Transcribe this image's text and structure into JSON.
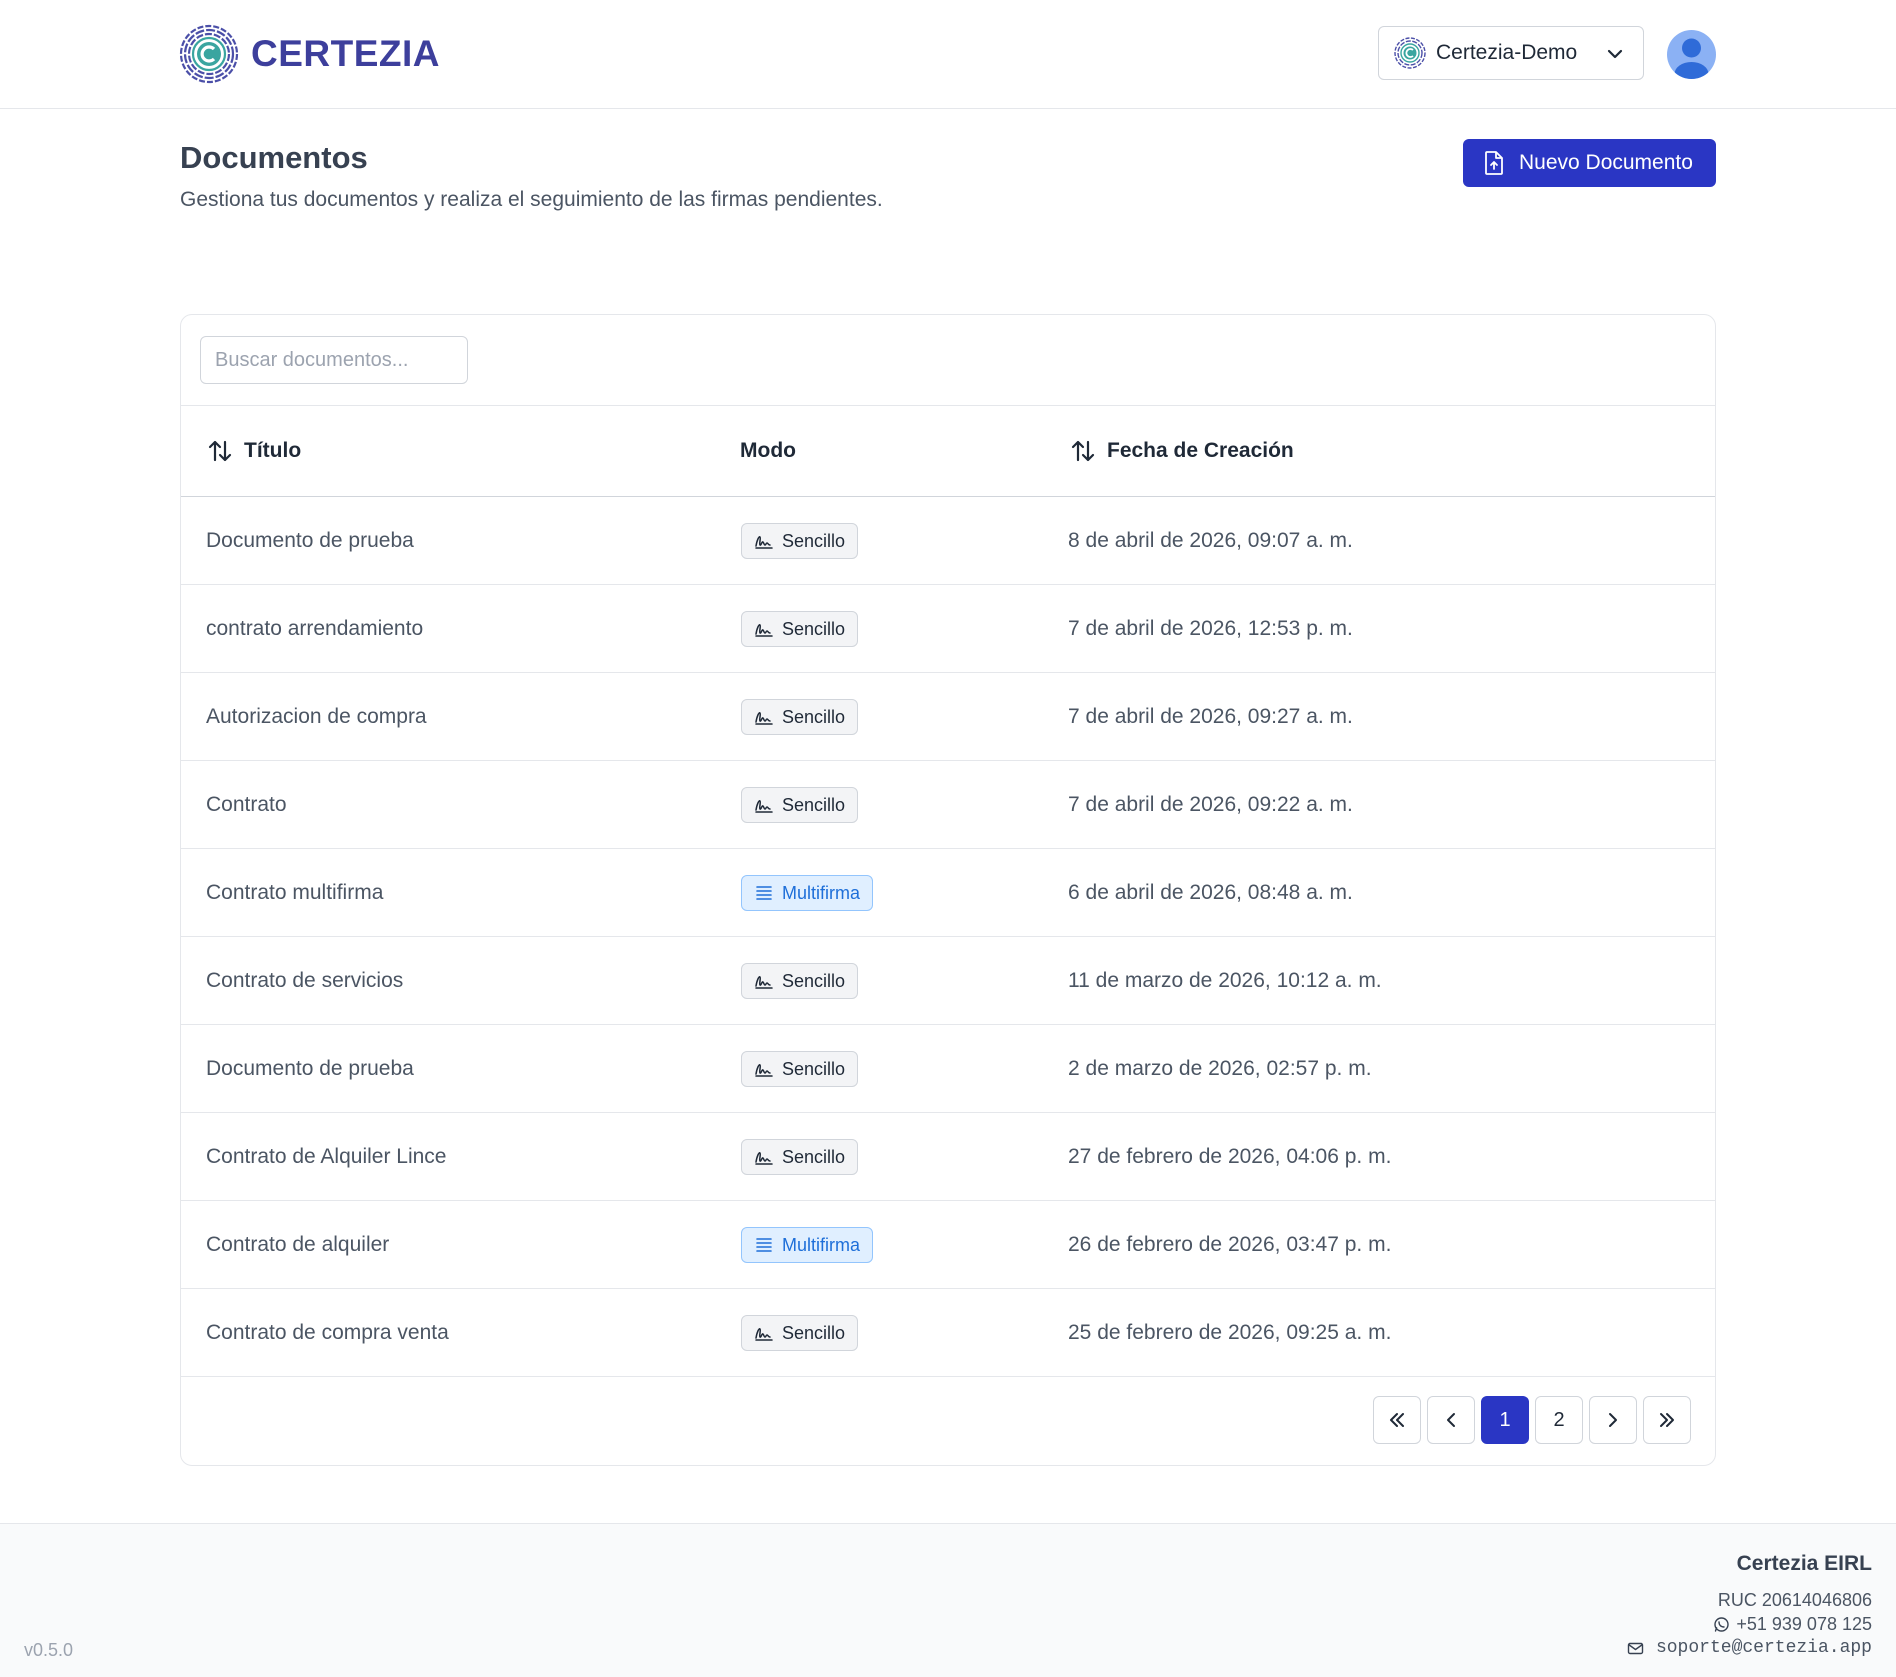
{
  "brand": {
    "name": "CERTEZIA",
    "color": "#3d3f9c"
  },
  "header": {
    "org_name": "Certezia-Demo",
    "org_icon": "certezia-logo-icon",
    "chevron_icon": "chevron-down-icon",
    "avatar_icon": "user-avatar-icon"
  },
  "page": {
    "title": "Documentos",
    "subtitle": "Gestiona tus documentos y realiza el seguimiento de las firmas pendientes.",
    "new_button_label": "Nuevo Documento",
    "new_button_icon": "file-upload-icon",
    "accent": "#2a36c4"
  },
  "search": {
    "placeholder": "Buscar documentos...",
    "value": ""
  },
  "table": {
    "columns": {
      "title": "Título",
      "mode": "Modo",
      "date": "Fecha de Creación"
    },
    "rows": [
      {
        "title": "Documento de prueba",
        "mode": "Sencillo",
        "mode_type": "single",
        "date": "8 de abril de 2026, 09:07 a. m."
      },
      {
        "title": "contrato arrendamiento",
        "mode": "Sencillo",
        "mode_type": "single",
        "date": "7 de abril de 2026, 12:53 p. m."
      },
      {
        "title": "Autorizacion de compra",
        "mode": "Sencillo",
        "mode_type": "single",
        "date": "7 de abril de 2026, 09:27 a. m."
      },
      {
        "title": "Contrato",
        "mode": "Sencillo",
        "mode_type": "single",
        "date": "7 de abril de 2026, 09:22 a. m."
      },
      {
        "title": "Contrato multifirma",
        "mode": "Multifirma",
        "mode_type": "multi",
        "date": "6 de abril de 2026, 08:48 a. m."
      },
      {
        "title": "Contrato de servicios",
        "mode": "Sencillo",
        "mode_type": "single",
        "date": "11 de marzo de 2026, 10:12 a. m."
      },
      {
        "title": "Documento de prueba",
        "mode": "Sencillo",
        "mode_type": "single",
        "date": "2 de marzo de 2026, 02:57 p. m."
      },
      {
        "title": "Contrato de Alquiler Lince",
        "mode": "Sencillo",
        "mode_type": "single",
        "date": "27 de febrero de 2026, 04:06 p. m."
      },
      {
        "title": "Contrato de alquiler",
        "mode": "Multifirma",
        "mode_type": "multi",
        "date": "26 de febrero de 2026, 03:47 p. m."
      },
      {
        "title": "Contrato de compra venta",
        "mode": "Sencillo",
        "mode_type": "single",
        "date": "25 de febrero de 2026, 09:25 a. m."
      }
    ]
  },
  "pagination": {
    "pages": [
      "1",
      "2"
    ],
    "current": "1"
  },
  "footer": {
    "version": "v0.5.0",
    "company": "Certezia EIRL",
    "ruc": "RUC 20614046806",
    "phone": "+51 939 078 125",
    "email": "soporte@certezia.app"
  }
}
